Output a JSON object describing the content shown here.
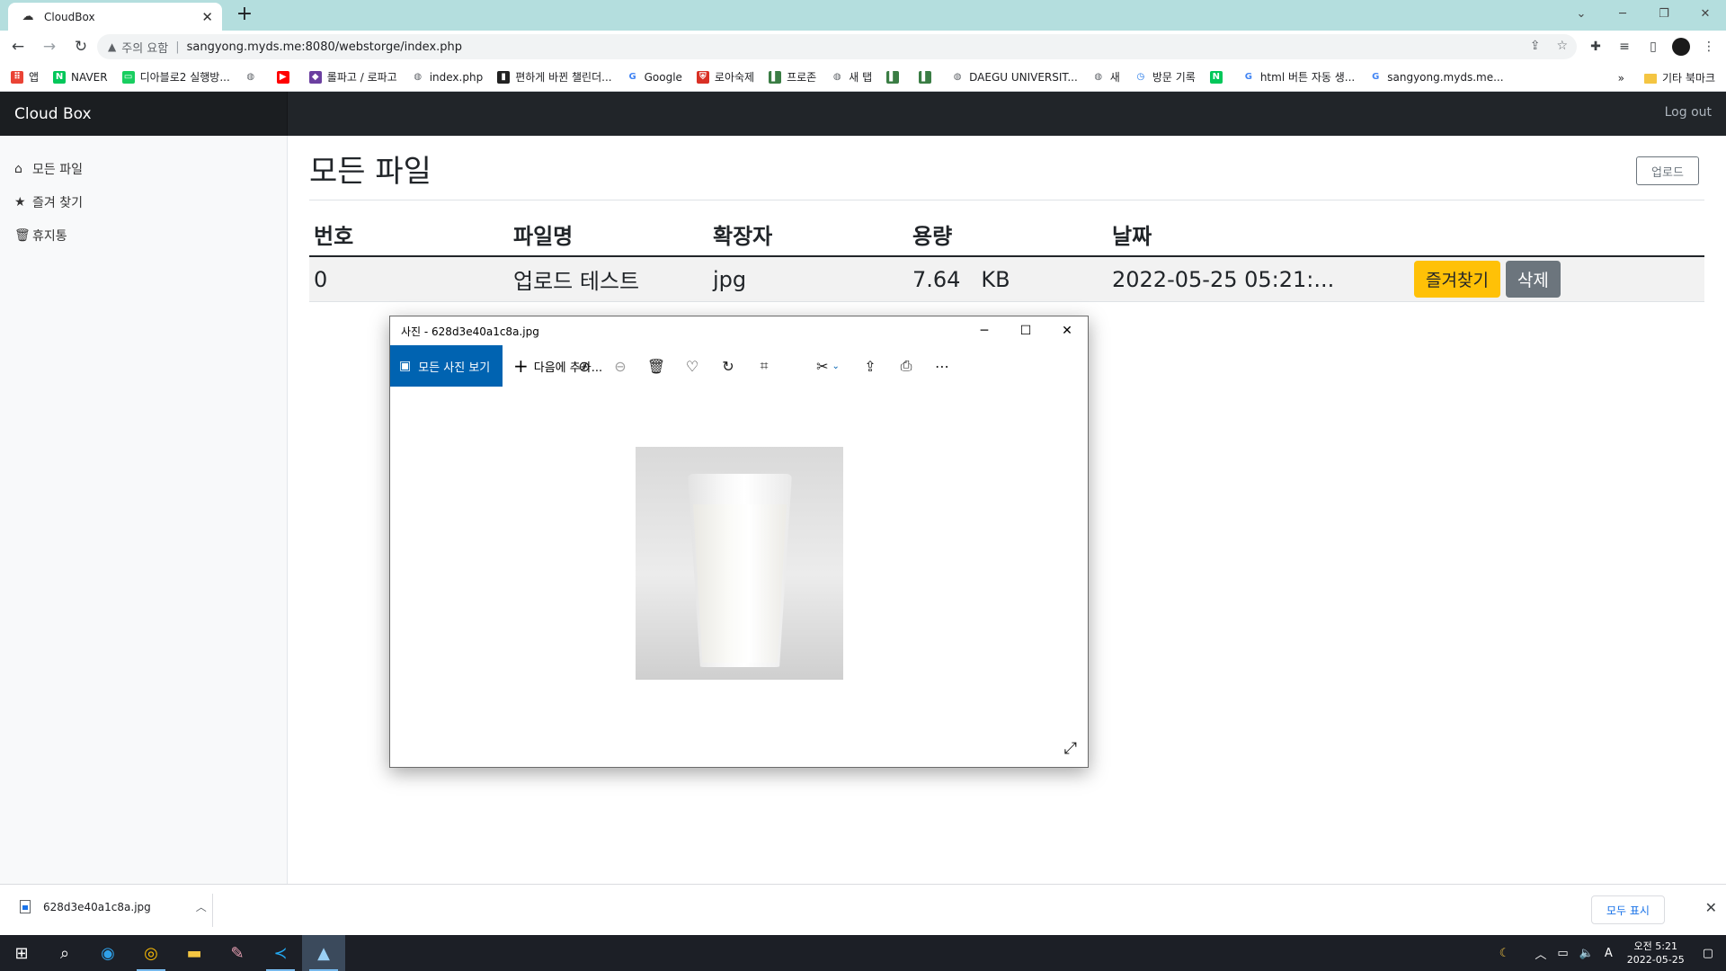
{
  "browser": {
    "tab_title": "CloudBox",
    "new_tab": "+",
    "warning_text": "주의 요함",
    "url": "sangyong.myds.me:8080/webstorge/index.php"
  },
  "bookmarks": [
    {
      "label": "앱",
      "icon": "apps-grid-icon",
      "color": "#ea4335"
    },
    {
      "label": "NAVER",
      "icon": "naver-icon",
      "color": "#03c75a"
    },
    {
      "label": "디아블로2 실행방...",
      "icon": "chat-icon",
      "color": "#19ce60"
    },
    {
      "label": "",
      "icon": "globe-icon",
      "color": "#5f6368"
    },
    {
      "label": "",
      "icon": "youtube-icon",
      "color": "#ff0000"
    },
    {
      "label": "롤파고 / 로파고",
      "icon": "lolpago-icon",
      "color": "#6b3fa0"
    },
    {
      "label": "index.php",
      "icon": "globe-icon",
      "color": "#5f6368"
    },
    {
      "label": "편하게 바뀐 챌린더...",
      "icon": "book-icon",
      "color": "#222222"
    },
    {
      "label": "Google",
      "icon": "google-icon",
      "color": "#4285f4"
    },
    {
      "label": "로아숙제",
      "icon": "shield-icon",
      "color": "#d93025"
    },
    {
      "label": "프로존",
      "icon": "bar-icon",
      "color": "#3a7d44"
    },
    {
      "label": "새 탭",
      "icon": "globe-icon",
      "color": "#5f6368"
    },
    {
      "label": "",
      "icon": "bar-icon",
      "color": "#3a7d44"
    },
    {
      "label": "",
      "icon": "bar-icon",
      "color": "#3a7d44"
    },
    {
      "label": "DAEGU UNIVERSIT...",
      "icon": "globe-icon",
      "color": "#5f6368"
    },
    {
      "label": "새",
      "icon": "globe-icon",
      "color": "#5f6368"
    },
    {
      "label": "방문 기록",
      "icon": "history-icon",
      "color": "#1a73e8"
    },
    {
      "label": "",
      "icon": "naver-icon",
      "color": "#03c75a"
    },
    {
      "label": "html 버튼 자동 생...",
      "icon": "google-icon",
      "color": "#4285f4"
    },
    {
      "label": "sangyong.myds.me...",
      "icon": "google-icon",
      "color": "#4285f4"
    }
  ],
  "bookmarks_more": "»",
  "bookmarks_other": "기타 북마크",
  "app": {
    "brand": "Cloud Box",
    "logout": "Log out",
    "sidebar": [
      {
        "label": "모든 파일",
        "icon": "home-icon"
      },
      {
        "label": "즐겨 찾기",
        "icon": "star-icon"
      },
      {
        "label": "휴지통",
        "icon": "trash-icon"
      }
    ],
    "page_title": "모든 파일",
    "upload_label": "업로드",
    "table": {
      "headers": [
        "번호",
        "파일명",
        "확장자",
        "용량",
        "날짜"
      ],
      "rows": [
        {
          "no": "0",
          "name": "업로드 테스트",
          "ext": "jpg",
          "size": "7.64   KB",
          "date": "2022-05-25 05:21:...",
          "fav_label": "즐겨찾기",
          "del_label": "삭제"
        }
      ]
    }
  },
  "photos_window": {
    "title": "사진 - 628d3e40a1c8a.jpg",
    "all_photos": "모든 사진 보기",
    "add_to": "다음에 추가..."
  },
  "download_bar": {
    "file": "628d3e40a1c8a.jpg",
    "show_all": "모두 표시"
  },
  "taskbar": {
    "time": "오전 5:21",
    "date": "2022-05-25",
    "ime": "A"
  }
}
